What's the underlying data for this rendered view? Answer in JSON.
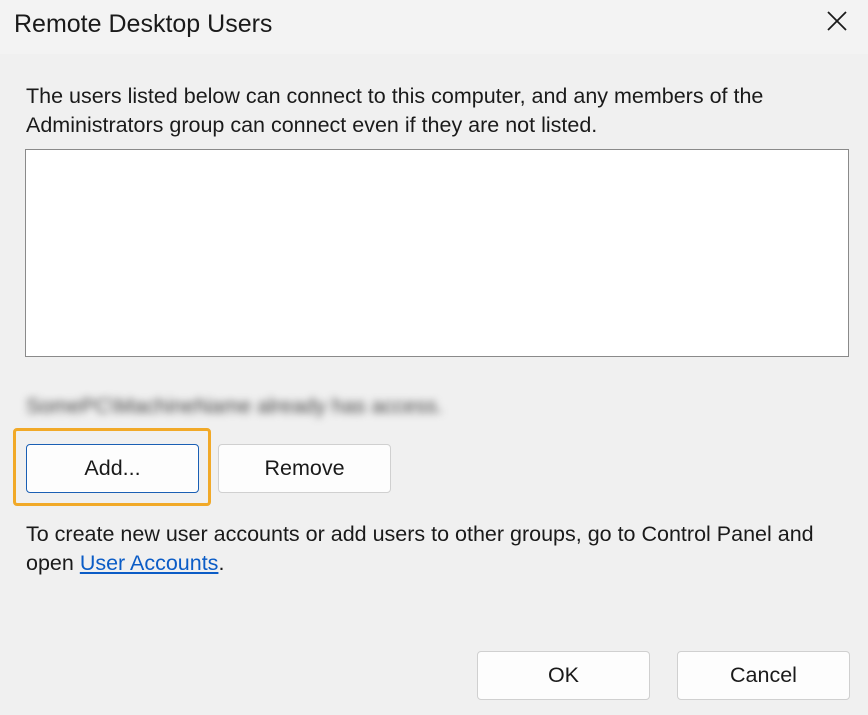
{
  "window": {
    "title": "Remote Desktop Users",
    "close_label": "✕"
  },
  "description": "The users listed below can connect to this computer, and any members of the Administrators group can connect even if they are not listed.",
  "user_list": {
    "items": []
  },
  "access_status": "SomePC\\MachineName already has access.",
  "buttons": {
    "add_label": "Add...",
    "remove_label": "Remove",
    "ok_label": "OK",
    "cancel_label": "Cancel"
  },
  "info": {
    "text_before": "To create new user accounts or add users to other groups, go to Control Panel and open ",
    "link_label": "User Accounts",
    "text_after": "."
  },
  "colors": {
    "highlight": "#f1a928",
    "link": "#0b5cc6",
    "primary_border": "#1a5fb4"
  }
}
